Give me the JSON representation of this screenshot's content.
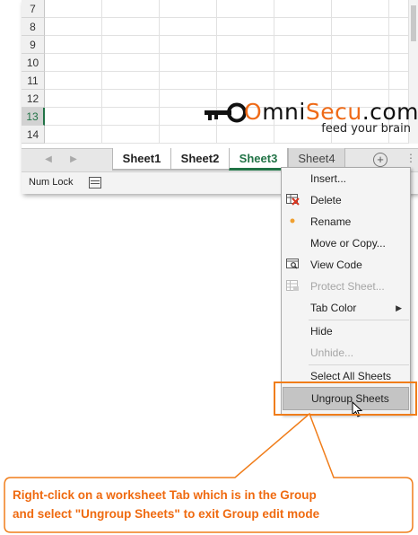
{
  "grid": {
    "rows": [
      {
        "num": "7",
        "selected": false
      },
      {
        "num": "8",
        "selected": false
      },
      {
        "num": "9",
        "selected": false
      },
      {
        "num": "10",
        "selected": false
      },
      {
        "num": "11",
        "selected": false
      },
      {
        "num": "12",
        "selected": false
      },
      {
        "num": "13",
        "selected": true
      },
      {
        "num": "14",
        "selected": false
      }
    ]
  },
  "logo": {
    "prefix": "O",
    "brand_1": "mni",
    "brand_2": "Secu",
    "suffix": ".com",
    "tagline": "feed your brain"
  },
  "tabs": [
    {
      "label": "Sheet1",
      "state": "grouped"
    },
    {
      "label": "Sheet2",
      "state": "grouped"
    },
    {
      "label": "Sheet3",
      "state": "active"
    },
    {
      "label": "Sheet4",
      "state": "plain"
    }
  ],
  "tabbar": {
    "add_sheet_symbol": "+",
    "more_symbol": "⋮",
    "nav_prev": "◀",
    "nav_next": "▶"
  },
  "status": {
    "mode": "Num Lock"
  },
  "context_menu": {
    "items": [
      {
        "label": "Insert...",
        "icon": "",
        "disabled": false
      },
      {
        "label": "Delete",
        "icon": "delete-table-icon",
        "disabled": false
      },
      {
        "label": "Rename",
        "icon": "bullet-dot",
        "disabled": false
      },
      {
        "label": "Move or Copy...",
        "icon": "",
        "disabled": false
      },
      {
        "label": "View Code",
        "icon": "view-code-icon",
        "disabled": false
      },
      {
        "label": "Protect Sheet...",
        "icon": "protect-sheet-icon",
        "disabled": true
      },
      {
        "label": "Tab Color",
        "icon": "",
        "disabled": false,
        "submenu": true
      },
      {
        "label": "Hide",
        "icon": "",
        "disabled": false
      },
      {
        "label": "Unhide...",
        "icon": "",
        "disabled": true
      },
      {
        "label": "Select All Sheets",
        "icon": "",
        "disabled": false
      },
      {
        "label": "Ungroup Sheets",
        "icon": "",
        "disabled": false,
        "hover": true
      }
    ],
    "submenu_arrow": "▶"
  },
  "callout": {
    "line1": "Right-click on a worksheet Tab which is in the Group",
    "line2": "and select \"Ungroup Sheets\" to exit Group edit mode"
  },
  "colors": {
    "accent_orange": "#f07d1a",
    "excel_green": "#217346",
    "callout_text": "#ef6a10"
  }
}
